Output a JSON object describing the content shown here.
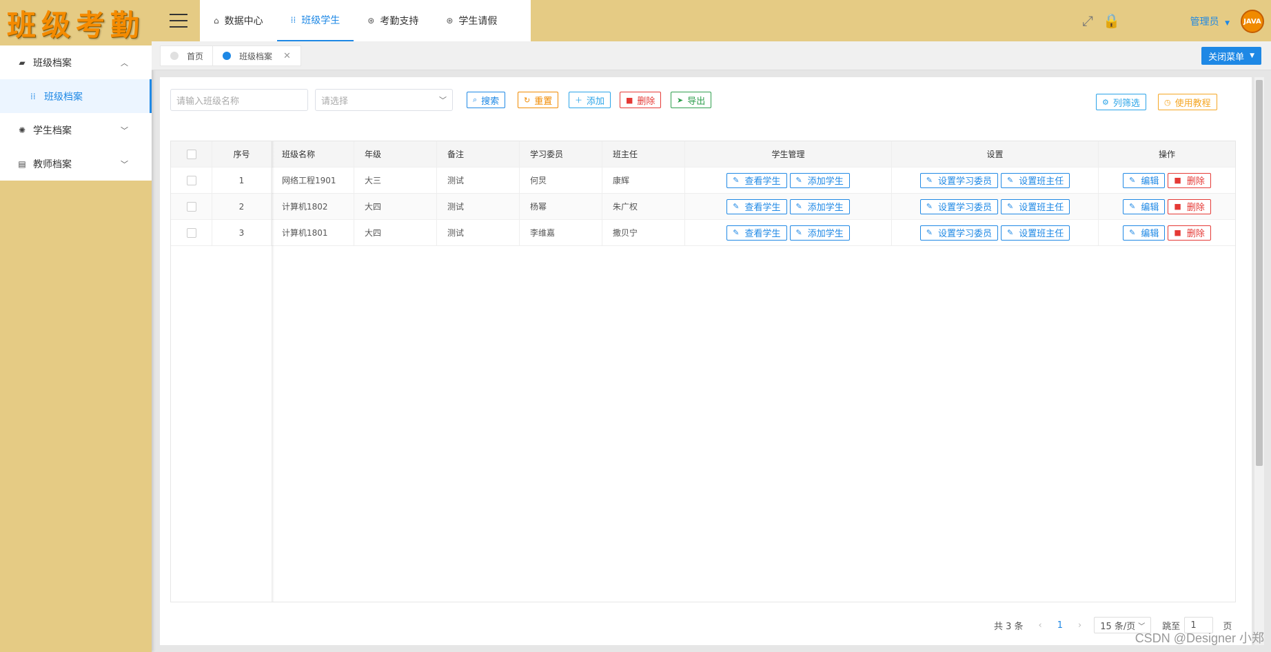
{
  "sidebar": {
    "logo": "班级考勤",
    "menu": [
      {
        "label": "班级档案",
        "icon": "chart-icon",
        "expanded": true
      },
      {
        "label": "学生档案",
        "icon": "palette-icon",
        "expanded": false
      },
      {
        "label": "教师档案",
        "icon": "basket-icon",
        "expanded": false
      }
    ],
    "sub_active": "班级档案"
  },
  "header": {
    "nav": [
      {
        "label": "数据中心",
        "icon": "home-icon"
      },
      {
        "label": "班级学生",
        "icon": "grid-icon"
      },
      {
        "label": "考勤支持",
        "icon": "support-icon"
      },
      {
        "label": "学生请假",
        "icon": "support-icon"
      }
    ],
    "active_nav": "班级学生",
    "admin_label": "管理员",
    "avatar_text": "JAVA"
  },
  "tags": {
    "home": "首页",
    "current": "班级档案",
    "close_menu": "关闭菜单"
  },
  "toolbar": {
    "class_name_placeholder": "请输入班级名称",
    "select_placeholder": "请选择",
    "search": "搜索",
    "reset": "重置",
    "add": "添加",
    "delete": "删除",
    "export": "导出",
    "column_filter": "列筛选",
    "tutorial": "使用教程"
  },
  "table": {
    "headers": {
      "index": "序号",
      "class_name": "班级名称",
      "grade": "年级",
      "remark": "备注",
      "study_rep": "学习委员",
      "head_teacher": "班主任",
      "student_mgmt": "学生管理",
      "settings": "设置",
      "actions": "操作"
    },
    "row_buttons": {
      "view_students": "查看学生",
      "add_students": "添加学生",
      "set_study_rep": "设置学习委员",
      "set_head_teacher": "设置班主任",
      "edit": "编辑",
      "delete": "删除"
    },
    "rows": [
      {
        "index": "1",
        "class_name": "网络工程1901",
        "grade": "大三",
        "remark": "测试",
        "study_rep": "何炅",
        "head_teacher": "康辉"
      },
      {
        "index": "2",
        "class_name": "计算机1802",
        "grade": "大四",
        "remark": "测试",
        "study_rep": "杨幂",
        "head_teacher": "朱广权"
      },
      {
        "index": "3",
        "class_name": "计算机1801",
        "grade": "大四",
        "remark": "测试",
        "study_rep": "李维嘉",
        "head_teacher": "撒贝宁"
      }
    ]
  },
  "pagination": {
    "total": "共 3 条",
    "current_page": "1",
    "page_size": "15 条/页",
    "jump_label": "跳至",
    "jump_value": "1",
    "page_suffix": "页"
  },
  "watermark": "CSDN @Designer 小郑"
}
